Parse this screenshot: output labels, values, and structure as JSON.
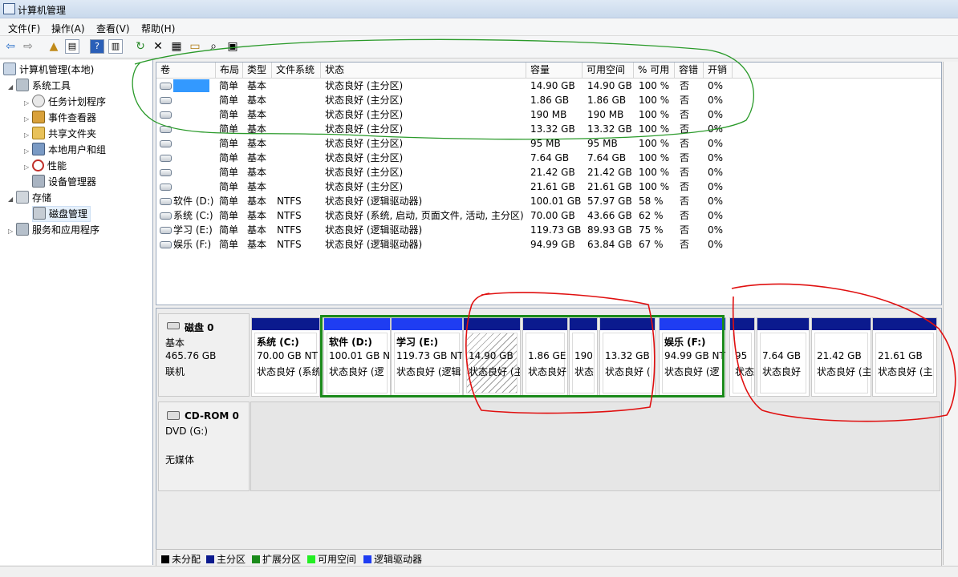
{
  "window": {
    "title": "计算机管理"
  },
  "menu": [
    "文件(F)",
    "操作(A)",
    "查看(V)",
    "帮助(H)"
  ],
  "tree": [
    {
      "label": "计算机管理(本地)",
      "icon": "computer-management-icon"
    },
    {
      "label": "系统工具",
      "icon": "tools-icon"
    },
    {
      "label": "任务计划程序",
      "icon": "clock-icon"
    },
    {
      "label": "事件查看器",
      "icon": "event-viewer-icon"
    },
    {
      "label": "共享文件夹",
      "icon": "shared-folder-icon"
    },
    {
      "label": "本地用户和组",
      "icon": "users-icon"
    },
    {
      "label": "性能",
      "icon": "performance-icon"
    },
    {
      "label": "设备管理器",
      "icon": "device-manager-icon"
    },
    {
      "label": "存储",
      "icon": "storage-icon"
    },
    {
      "label": "磁盘管理",
      "icon": "disk-management-icon"
    },
    {
      "label": "服务和应用程序",
      "icon": "services-icon"
    }
  ],
  "columns": [
    "卷",
    "布局",
    "类型",
    "文件系统",
    "状态",
    "容量",
    "可用空间",
    "% 可用",
    "容错",
    "开销"
  ],
  "volumes": [
    {
      "name": "",
      "layout": "简单",
      "type": "基本",
      "fs": "",
      "status": "状态良好 (主分区)",
      "capacity": "14.90 GB",
      "free": "14.90 GB",
      "pct": "100 %",
      "ft": "否",
      "overhead": "0%"
    },
    {
      "name": "",
      "layout": "简单",
      "type": "基本",
      "fs": "",
      "status": "状态良好 (主分区)",
      "capacity": "1.86 GB",
      "free": "1.86 GB",
      "pct": "100 %",
      "ft": "否",
      "overhead": "0%"
    },
    {
      "name": "",
      "layout": "简单",
      "type": "基本",
      "fs": "",
      "status": "状态良好 (主分区)",
      "capacity": "190 MB",
      "free": "190 MB",
      "pct": "100 %",
      "ft": "否",
      "overhead": "0%"
    },
    {
      "name": "",
      "layout": "简单",
      "type": "基本",
      "fs": "",
      "status": "状态良好 (主分区)",
      "capacity": "13.32 GB",
      "free": "13.32 GB",
      "pct": "100 %",
      "ft": "否",
      "overhead": "0%"
    },
    {
      "name": "",
      "layout": "简单",
      "type": "基本",
      "fs": "",
      "status": "状态良好 (主分区)",
      "capacity": "95 MB",
      "free": "95 MB",
      "pct": "100 %",
      "ft": "否",
      "overhead": "0%"
    },
    {
      "name": "",
      "layout": "简单",
      "type": "基本",
      "fs": "",
      "status": "状态良好 (主分区)",
      "capacity": "7.64 GB",
      "free": "7.64 GB",
      "pct": "100 %",
      "ft": "否",
      "overhead": "0%"
    },
    {
      "name": "",
      "layout": "简单",
      "type": "基本",
      "fs": "",
      "status": "状态良好 (主分区)",
      "capacity": "21.42 GB",
      "free": "21.42 GB",
      "pct": "100 %",
      "ft": "否",
      "overhead": "0%"
    },
    {
      "name": "",
      "layout": "简单",
      "type": "基本",
      "fs": "",
      "status": "状态良好 (主分区)",
      "capacity": "21.61 GB",
      "free": "21.61 GB",
      "pct": "100 %",
      "ft": "否",
      "overhead": "0%"
    },
    {
      "name": "软件 (D:)",
      "layout": "简单",
      "type": "基本",
      "fs": "NTFS",
      "status": "状态良好 (逻辑驱动器)",
      "capacity": "100.01 GB",
      "free": "57.97 GB",
      "pct": "58 %",
      "ft": "否",
      "overhead": "0%"
    },
    {
      "name": "系统 (C:)",
      "layout": "简单",
      "type": "基本",
      "fs": "NTFS",
      "status": "状态良好 (系统, 启动, 页面文件, 活动, 主分区)",
      "capacity": "70.00 GB",
      "free": "43.66 GB",
      "pct": "62 %",
      "ft": "否",
      "overhead": "0%"
    },
    {
      "name": "学习 (E:)",
      "layout": "简单",
      "type": "基本",
      "fs": "NTFS",
      "status": "状态良好 (逻辑驱动器)",
      "capacity": "119.73 GB",
      "free": "89.93 GB",
      "pct": "75 %",
      "ft": "否",
      "overhead": "0%"
    },
    {
      "name": "娱乐 (F:)",
      "layout": "简单",
      "type": "基本",
      "fs": "NTFS",
      "status": "状态良好 (逻辑驱动器)",
      "capacity": "94.99 GB",
      "free": "63.84 GB",
      "pct": "67 %",
      "ft": "否",
      "overhead": "0%"
    }
  ],
  "disk0": {
    "name": "磁盘 0",
    "type": "基本",
    "size": "465.76 GB",
    "state": "联机"
  },
  "partitions": [
    {
      "name": "系统  (C:)",
      "size": "70.00 GB NT",
      "status": "状态良好 (系统",
      "bar_color": "#0b1a8e"
    },
    {
      "name": "软件  (D:)",
      "size": "100.01 GB N",
      "status": "状态良好 (逻",
      "bar_color": "#1f3df2"
    },
    {
      "name": "学习  (E:)",
      "size": "119.73 GB NT",
      "status": "状态良好 (逻辑",
      "bar_color": "#1f3df2"
    },
    {
      "name": "",
      "size": "14.90 GB",
      "status": "状态良好 (主",
      "bar_color": "#0b1a8e"
    },
    {
      "name": "",
      "size": "1.86 GE",
      "status": "状态良好",
      "bar_color": "#0b1a8e"
    },
    {
      "name": "",
      "size": "190",
      "status": "状态",
      "bar_color": "#0b1a8e"
    },
    {
      "name": "",
      "size": "13.32 GB",
      "status": "状态良好 (",
      "bar_color": "#0b1a8e"
    },
    {
      "name": "娱乐  (F:)",
      "size": "94.99 GB NT",
      "status": "状态良好 (逻",
      "bar_color": "#1f3df2"
    },
    {
      "name": "",
      "size": "95",
      "status": "状态",
      "bar_color": "#0b1a8e"
    },
    {
      "name": "",
      "size": "7.64 GB",
      "status": "状态良好",
      "bar_color": "#0b1a8e"
    },
    {
      "name": "",
      "size": "21.42 GB",
      "status": "状态良好 (主",
      "bar_color": "#0b1a8e"
    },
    {
      "name": "",
      "size": "21.61 GB",
      "status": "状态良好 (主",
      "bar_color": "#0b1a8e"
    }
  ],
  "cdrom": {
    "name": "CD-ROM 0",
    "drive": "DVD (G:)",
    "media": "无媒体"
  },
  "legend": [
    {
      "label": "未分配",
      "color": "#000000"
    },
    {
      "label": "主分区",
      "color": "#0b1a8e"
    },
    {
      "label": "扩展分区",
      "color": "#1a8a1a"
    },
    {
      "label": "可用空间",
      "color": "#22ee22"
    },
    {
      "label": "逻辑驱动器",
      "color": "#1f3df2"
    }
  ],
  "colors": {
    "highlight_extended": "#1a8a1a",
    "annotation_red": "#e01010",
    "annotation_green": "#2a9a2a"
  }
}
